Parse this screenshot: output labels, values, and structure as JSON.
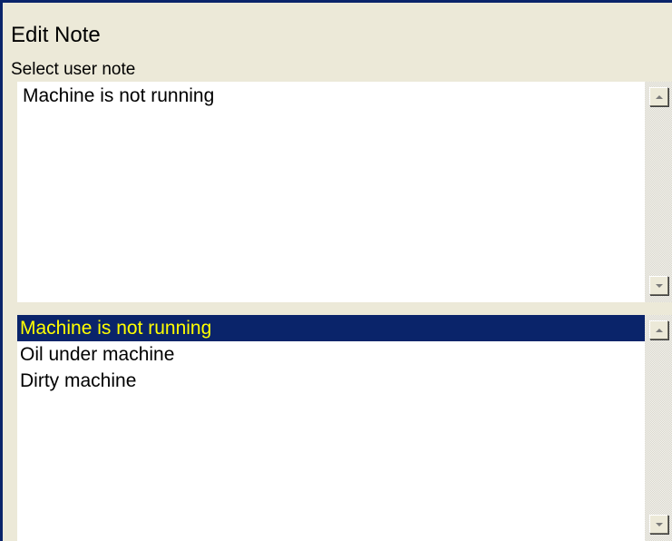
{
  "header": {
    "title": "Edit Note",
    "subtitle": "Select user note"
  },
  "note_field": {
    "value": "Machine is not running"
  },
  "notes_list": {
    "items": [
      "Machine is not running",
      "Oil under machine",
      "Dirty machine"
    ],
    "selected_index": 0
  },
  "icons": {
    "scroll_up": "scroll-up-arrow-icon",
    "scroll_down": "scroll-down-arrow-icon"
  },
  "colors": {
    "window_bg": "#ECE9D8",
    "frame_border": "#0A246A",
    "selection_bg": "#0A246A",
    "selection_text": "#FFFF00",
    "list_bg": "#FFFFFF"
  }
}
